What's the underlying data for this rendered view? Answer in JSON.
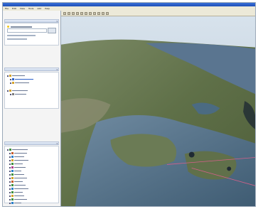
{
  "window": {
    "accent_color": "#2a5fca",
    "chrome_color": "#ece9d8"
  },
  "menubar": {
    "items": [
      "File",
      "Edit",
      "View",
      "Tools",
      "Add",
      "Help"
    ]
  },
  "sidebar": {
    "search": {
      "icon": "search-icon"
    },
    "places": {
      "icon": "folder-icon"
    },
    "layers": {
      "icon": "layers-icon"
    }
  },
  "toolbar": {
    "icons": [
      "hide-sidebar-icon",
      "placemark-icon",
      "polygon-icon",
      "path-icon",
      "overlay-icon",
      "tour-icon",
      "sky-icon",
      "ruler-icon",
      "email-icon",
      "print-icon",
      "maps-icon"
    ]
  },
  "map": {
    "description_colors": {
      "sky": "#c9d8e8",
      "sea": "#4b6b82",
      "land": "#5f7048",
      "terrain": "#8a8a70"
    }
  }
}
